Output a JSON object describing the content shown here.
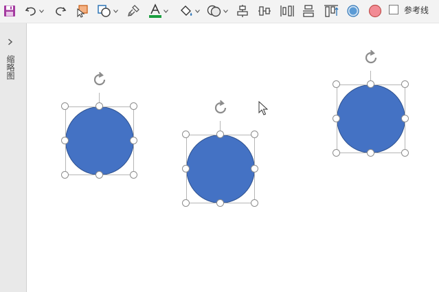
{
  "toolbar": {
    "buttons": [
      {
        "name": "save-icon",
        "caret": false
      },
      {
        "name": "undo-icon",
        "caret": true
      },
      {
        "name": "redo-icon",
        "caret": false
      },
      {
        "name": "select-shape-icon",
        "caret": false
      },
      {
        "name": "shapes-icon",
        "caret": true
      },
      {
        "name": "format-painter-icon",
        "caret": false
      },
      {
        "name": "font-color-icon",
        "caret": true
      },
      {
        "name": "fill-color-icon",
        "caret": true
      },
      {
        "name": "merge-shapes-icon",
        "caret": true
      },
      {
        "name": "align-center-horizontal-icon",
        "caret": false
      },
      {
        "name": "distribute-horizontal-icon",
        "caret": false
      },
      {
        "name": "distribute-vertical-icon",
        "caret": false
      },
      {
        "name": "align-middle-icon",
        "caret": false
      },
      {
        "name": "align-top-icon",
        "caret": false
      },
      {
        "name": "shape-style-blue-icon",
        "caret": false
      },
      {
        "name": "shape-style-red-icon",
        "caret": false
      }
    ],
    "font_color_accent": "#1a9e3f",
    "reference_line_label": "参考线",
    "reference_line_checked": false
  },
  "side_panel": {
    "label": "缩略图",
    "expand_icon": "chevron-right-icon"
  },
  "canvas": {
    "shapes": [
      {
        "type": "circle",
        "fill": "#4472c4",
        "selected": true
      },
      {
        "type": "circle",
        "fill": "#4472c4",
        "selected": true
      },
      {
        "type": "circle",
        "fill": "#4472c4",
        "selected": true
      }
    ]
  }
}
